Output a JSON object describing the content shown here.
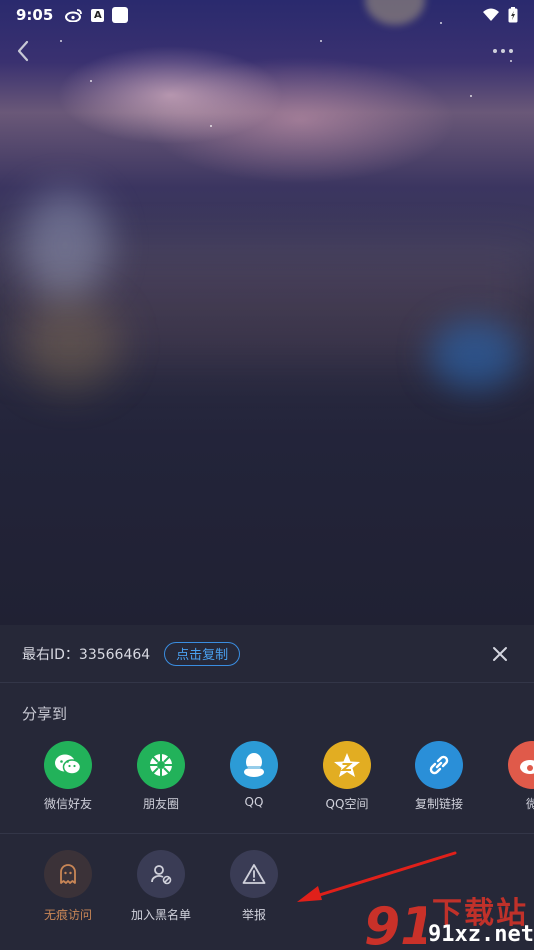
{
  "status_bar": {
    "time": "9:05",
    "left_icons": [
      "weibo-icon",
      "a-icon",
      "square-icon"
    ],
    "right_icons": [
      "wifi-icon",
      "battery-charging-icon"
    ],
    "a_icon_text": "A"
  },
  "nav": {
    "back_icon": "chevron-left-icon",
    "more_icon": "more-horizontal-icon"
  },
  "sheet": {
    "id_text": "最右ID：33566464",
    "copy_label": "点击复制",
    "close_icon": "close-icon",
    "share_title": "分享到",
    "share_items": [
      {
        "label": "微信好友",
        "icon": "wechat-icon",
        "color": "#22b25a"
      },
      {
        "label": "朋友圈",
        "icon": "moments-icon",
        "color": "#22b25a"
      },
      {
        "label": "QQ",
        "icon": "qq-icon",
        "color": "#2c9bd6"
      },
      {
        "label": "QQ空间",
        "icon": "qzone-icon",
        "color": "#e2ad22"
      },
      {
        "label": "复制链接",
        "icon": "link-icon",
        "color": "#2a8fd8"
      },
      {
        "label": "微",
        "icon": "weibo-icon",
        "color": "#e05a4a"
      }
    ],
    "actions": [
      {
        "label": "无痕访问",
        "icon": "ghost-icon"
      },
      {
        "label": "加入黑名单",
        "icon": "block-user-icon"
      },
      {
        "label": "举报",
        "icon": "warning-icon"
      }
    ]
  },
  "colors": {
    "accent_blue": "#3a8de0",
    "sheet_bg": "#262838",
    "ghost_orange": "#c98656",
    "arrow_red": "#e0201a"
  },
  "watermark": {
    "brand": "下载站",
    "logo": "91",
    "url": "91xz.net"
  }
}
